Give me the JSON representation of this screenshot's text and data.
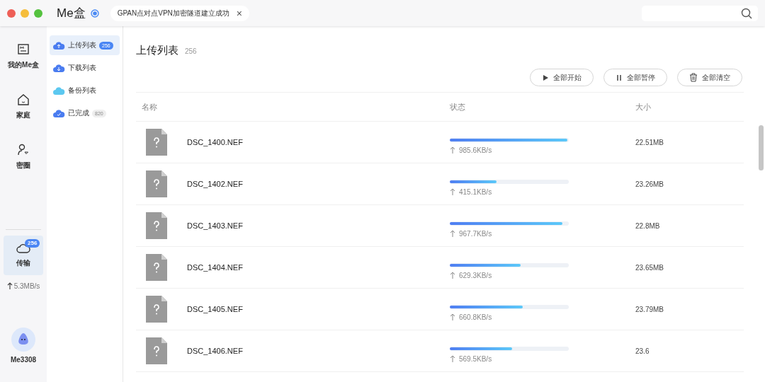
{
  "app": {
    "title": "Me盒",
    "notice": "GPAN点对点VPN加密隧道建立成功",
    "notice_close": "×"
  },
  "rail": {
    "items": [
      {
        "label": "我的Me盒",
        "selected": false
      },
      {
        "label": "家庭",
        "selected": false
      },
      {
        "label": "密圈",
        "selected": false
      }
    ],
    "transfer": {
      "label": "传输",
      "badge": "256",
      "selected": true
    },
    "speed": "5.3MB/s",
    "user": "Me3308"
  },
  "lists": [
    {
      "label": "上传列表",
      "badge": "256",
      "selected": true
    },
    {
      "label": "下载列表",
      "selected": false
    },
    {
      "label": "备份列表",
      "selected": false
    },
    {
      "label": "已完成",
      "badge": "820",
      "selected": false
    }
  ],
  "main": {
    "title": "上传列表",
    "count": "256",
    "buttons": [
      {
        "label": "全部开始"
      },
      {
        "label": "全部暂停"
      },
      {
        "label": "全部清空"
      }
    ],
    "columns": [
      "名称",
      "状态",
      "大小"
    ],
    "rows": [
      {
        "name": "DSC_1400.NEF",
        "level": 1.0,
        "speed": "985.6KB/s",
        "size": "22.51MB"
      },
      {
        "name": "DSC_1402.NEF",
        "level": 0.4,
        "speed": "415.1KB/s",
        "size": "23.26MB"
      },
      {
        "name": "DSC_1403.NEF",
        "level": 0.96,
        "speed": "967.7KB/s",
        "size": "22.8MB"
      },
      {
        "name": "DSC_1404.NEF",
        "level": 0.6,
        "speed": "629.3KB/s",
        "size": "23.65MB"
      },
      {
        "name": "DSC_1405.NEF",
        "level": 0.62,
        "speed": "660.8KB/s",
        "size": "23.79MB"
      },
      {
        "name": "DSC_1406.NEF",
        "level": 0.53,
        "speed": "569.5KB/s",
        "size": "23.6"
      }
    ]
  }
}
